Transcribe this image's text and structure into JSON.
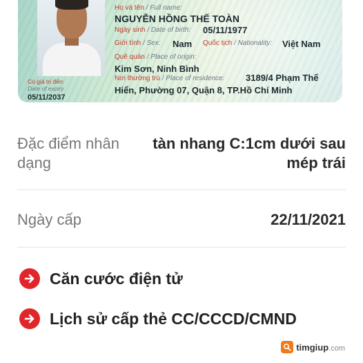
{
  "card": {
    "fullname_label": "Họ và tên",
    "fullname_label_en": "/ Full name:",
    "fullname": "NGUYỄN HỒNG THẾ TOÀN",
    "dob_label": "Ngày sinh",
    "dob_label_en": "/ Date of birth:",
    "dob": "05/11/1977",
    "sex_label": "Giới tính",
    "sex_label_en": "/ Sex:",
    "sex": "Nam",
    "nationality_label": "Quốc tịch",
    "nationality_label_en": "/ Nationality:",
    "nationality": "Việt Nam",
    "origin_label": "Quê quán",
    "origin_label_en": "/ Place of origin:",
    "origin": "Kim Sơn, Ninh Bình",
    "residence_label": "Nơi thường trú",
    "residence_label_en": "/ Place of residence:",
    "residence_line1": "3189/4 Phạm Thế",
    "residence_line2": "Hiển, Phường 07, Quận 8, TP.Hồ Chí Minh",
    "expiry_label": "Có giá trị đến:",
    "expiry_label_en": "Date of expiry",
    "expiry": "05/11/2037"
  },
  "identifying_marks": {
    "label_line1": "Đặc điểm nhân",
    "label_line2": "dạng",
    "value_line1": "tàn nhang C:1cm dưới sau",
    "value_line2": "mép trái"
  },
  "issue_date": {
    "label": "Ngày cấp",
    "value": "22/11/2021"
  },
  "links": {
    "electronic_id": "Căn cước điện tử",
    "issue_history": "Lịch sử cấp thẻ CC/CCCD/CMND"
  },
  "watermark": {
    "brand": "timgiup",
    "domain": ".com"
  },
  "colors": {
    "accent_red": "#e0262b",
    "brand_orange": "#f07a1a"
  }
}
